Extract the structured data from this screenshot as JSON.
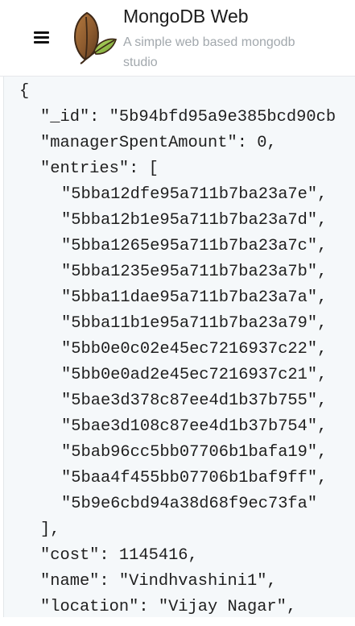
{
  "header": {
    "title": "MongoDB Web",
    "subtitle": "A simple web based mongodb studio",
    "menu_icon": "hamburger-menu-icon",
    "logo_icon": "mongodb-leaf-logo"
  },
  "colors": {
    "background": "#ffffff",
    "document_background": "#f5f8fa",
    "title_text": "#1b1b1b",
    "subtitle_text": "#a2a8ad",
    "code_text": "#1f1f1f",
    "leaf_brown": "#8c5a2e",
    "leaf_green": "#86b83d"
  },
  "document": {
    "lines": [
      {
        "indent": 0,
        "text": "{"
      },
      {
        "indent": 1,
        "text": "\"_id\": \"5b94bfd95a9e385bcd90cb"
      },
      {
        "indent": 1,
        "text": "\"managerSpentAmount\": 0,"
      },
      {
        "indent": 1,
        "text": "\"entries\": ["
      },
      {
        "indent": 2,
        "text": "\"5bba12dfe95a711b7ba23a7e\","
      },
      {
        "indent": 2,
        "text": "\"5bba12b1e95a711b7ba23a7d\","
      },
      {
        "indent": 2,
        "text": "\"5bba1265e95a711b7ba23a7c\","
      },
      {
        "indent": 2,
        "text": "\"5bba1235e95a711b7ba23a7b\","
      },
      {
        "indent": 2,
        "text": "\"5bba11dae95a711b7ba23a7a\","
      },
      {
        "indent": 2,
        "text": "\"5bba11b1e95a711b7ba23a79\","
      },
      {
        "indent": 2,
        "text": "\"5bb0e0c02e45ec7216937c22\","
      },
      {
        "indent": 2,
        "text": "\"5bb0e0ad2e45ec7216937c21\","
      },
      {
        "indent": 2,
        "text": "\"5bae3d378c87ee4d1b37b755\","
      },
      {
        "indent": 2,
        "text": "\"5bae3d108c87ee4d1b37b754\","
      },
      {
        "indent": 2,
        "text": "\"5bab96cc5bb07706b1bafa19\","
      },
      {
        "indent": 2,
        "text": "\"5baa4f455bb07706b1baf9ff\","
      },
      {
        "indent": 2,
        "text": "\"5b9e6cbd94a38d68f9ec73fa\""
      },
      {
        "indent": 1,
        "text": "],"
      },
      {
        "indent": 1,
        "text": "\"cost\": 1145416,"
      },
      {
        "indent": 1,
        "text": "\"name\": \"Vindhvashini1\","
      },
      {
        "indent": 1,
        "text": "\"location\": \"Vijay Nagar\","
      }
    ]
  }
}
